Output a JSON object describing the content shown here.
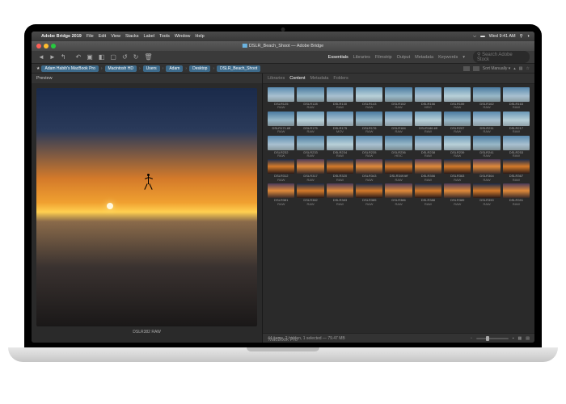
{
  "menubar": {
    "app": "Adobe Bridge 2019",
    "items": [
      "File",
      "Edit",
      "View",
      "Stacks",
      "Label",
      "Tools",
      "Window",
      "Help"
    ],
    "clock": "Wed 9:41 AM"
  },
  "window": {
    "title": "DSLR_Beach_Shoot — Adobe Bridge"
  },
  "workspaces": [
    "Essentials",
    "Libraries",
    "Filmstrip",
    "Output",
    "Metadata",
    "Keywords"
  ],
  "active_workspace": "Essentials",
  "search_placeholder": "Search Adobe Stock",
  "breadcrumb": [
    "Adam Habib's MacBook Pro",
    "Macintosh HD",
    "Users",
    "Adam",
    "Desktop",
    "DSLR_Beach_Shoot"
  ],
  "sort": {
    "label": "Sort Manually"
  },
  "preview": {
    "tab": "Preview",
    "selected": {
      "name": "DSLR382",
      "type": "RAW"
    }
  },
  "content_tabs": [
    "Libraries",
    "Content",
    "Metadata",
    "Folders"
  ],
  "active_content_tab": "Content",
  "thumbs": [
    [
      {
        "n": "DSLR125",
        "t": "RAW",
        "c": "sky1"
      },
      {
        "n": "DSLR128",
        "t": "RAW",
        "c": "sky2"
      },
      {
        "n": "DSLR130",
        "t": "RAW",
        "c": "sky1"
      },
      {
        "n": "DSLR143",
        "t": "RAW",
        "c": "sky3"
      },
      {
        "n": "DSLR152",
        "t": "RAW",
        "c": "sky2"
      },
      {
        "n": "DSLR156",
        "t": "HEIC",
        "c": "sky1"
      },
      {
        "n": "DSLR159",
        "t": "RAW",
        "c": "sky3"
      },
      {
        "n": "DSLR162",
        "t": "RAW",
        "c": "sky2"
      },
      {
        "n": "DSLR163",
        "t": "RAW",
        "c": "sky1"
      }
    ],
    [
      {
        "n": "DSLR171.tiff",
        "t": "RAW",
        "c": "sky2"
      },
      {
        "n": "DSLR175",
        "t": "RAW",
        "c": "sky3"
      },
      {
        "n": "DSLR175",
        "t": "MOV",
        "c": "sky1"
      },
      {
        "n": "DSLR176",
        "t": "RAW",
        "c": "sky2"
      },
      {
        "n": "DSLR184",
        "t": "RAW",
        "c": "sky1"
      },
      {
        "n": "DSLR186.tiff",
        "t": "RAW",
        "c": "sky3"
      },
      {
        "n": "DSLR207",
        "t": "RAW",
        "c": "sky2"
      },
      {
        "n": "DSLR211",
        "t": "RAW",
        "c": "sky1"
      },
      {
        "n": "DSLR217",
        "t": "RAW",
        "c": "sky3"
      }
    ],
    [
      {
        "n": "DSLR232",
        "t": "RAW",
        "c": "sky1"
      },
      {
        "n": "DSLR233",
        "t": "RAW",
        "c": "sky2"
      },
      {
        "n": "DSLR234",
        "t": "RAW",
        "c": "sky3"
      },
      {
        "n": "DSLR235",
        "t": "RAW",
        "c": "sky1"
      },
      {
        "n": "DSLR236",
        "t": "HEIC",
        "c": "sky2"
      },
      {
        "n": "DSLR238",
        "t": "RAW",
        "c": "sky1"
      },
      {
        "n": "DSLR239",
        "t": "RAW",
        "c": "sky3"
      },
      {
        "n": "DSLR241",
        "t": "RAW",
        "c": "sky2"
      },
      {
        "n": "DSLR253",
        "t": "RAW",
        "c": "sky1"
      }
    ],
    [
      {
        "n": "DSLR312",
        "t": "RAW",
        "c": "sun1"
      },
      {
        "n": "DSLR317",
        "t": "RAW",
        "c": "sun2"
      },
      {
        "n": "DSLR320",
        "t": "RAW",
        "c": "sun1"
      },
      {
        "n": "DSLR343",
        "t": "RAW",
        "c": "sun2"
      },
      {
        "n": "DSLR349.tiff",
        "t": "RAW",
        "c": "sun1"
      },
      {
        "n": "DSLR356",
        "t": "RAW",
        "c": "sun2"
      },
      {
        "n": "DSLR363",
        "t": "RAW",
        "c": "sun1"
      },
      {
        "n": "DSLR364",
        "t": "RAW",
        "c": "sun2"
      },
      {
        "n": "DSLR367",
        "t": "RAW",
        "c": "sun1"
      }
    ],
    [
      {
        "n": "DSLR381",
        "t": "RAW",
        "c": "sun2"
      },
      {
        "n": "DSLR382",
        "t": "RAW",
        "c": "sun1"
      },
      {
        "n": "DSLR383",
        "t": "RAW",
        "c": "sun2"
      },
      {
        "n": "DSLR385",
        "t": "RAW",
        "c": "sun1"
      },
      {
        "n": "DSLR386",
        "t": "RAW",
        "c": "sun2"
      },
      {
        "n": "DSLR388",
        "t": "RAW",
        "c": "sun1"
      },
      {
        "n": "DSLR389",
        "t": "RAW",
        "c": "sun2"
      },
      {
        "n": "DSLR390",
        "t": "RAW",
        "c": "sun1"
      },
      {
        "n": "DSLR391",
        "t": "RAW",
        "c": "sun2"
      }
    ]
  ],
  "status": {
    "text": "44 items, 2 hidden, 1 selected — 79.47 MB"
  },
  "laptop_model": "MacBook Pro"
}
